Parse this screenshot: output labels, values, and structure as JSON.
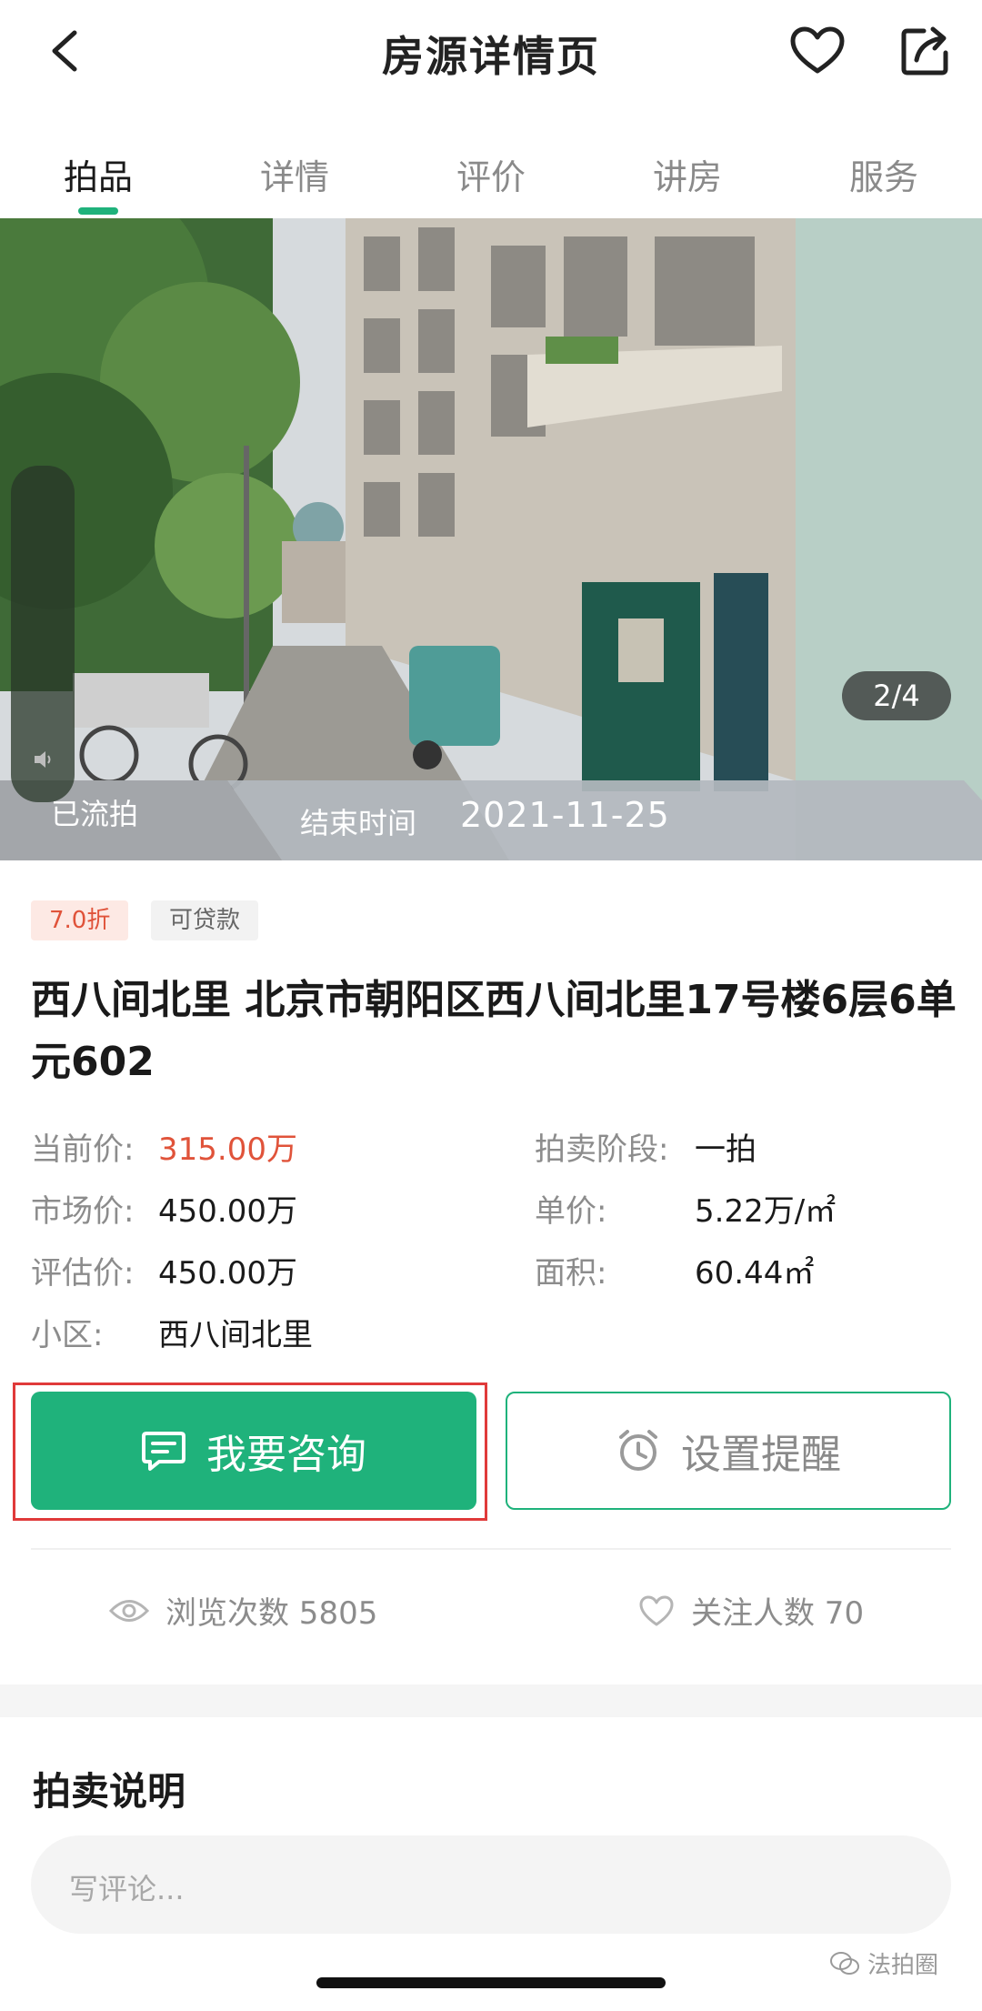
{
  "header": {
    "title": "房源详情页",
    "back_icon": "chevron-left-icon",
    "favorite_icon": "heart-icon",
    "share_icon": "share-icon"
  },
  "tabs": [
    {
      "label": "拍品",
      "active": true
    },
    {
      "label": "详情",
      "active": false
    },
    {
      "label": "评价",
      "active": false
    },
    {
      "label": "讲房",
      "active": false
    },
    {
      "label": "服务",
      "active": false
    }
  ],
  "hero": {
    "counter": "2/4",
    "status": "已流拍",
    "end_time_label": "结束时间",
    "end_time_value": "2021-11-25"
  },
  "tags": {
    "discount": "7.0折",
    "loan": "可贷款"
  },
  "property": {
    "title": "西八间北里 北京市朝阳区西八间北里17号楼6层6单元602"
  },
  "info": {
    "current_price_label": "当前价:",
    "current_price_value": "315.00万",
    "stage_label": "拍卖阶段:",
    "stage_value": "一拍",
    "market_price_label": "市场价:",
    "market_price_value": "450.00万",
    "unit_price_label": "单价:",
    "unit_price_value": "5.22万/㎡",
    "assessed_price_label": "评估价:",
    "assessed_price_value": "450.00万",
    "area_label": "面积:",
    "area_value": "60.44㎡",
    "community_label": "小区:",
    "community_value": "西八间北里"
  },
  "actions": {
    "consult_label": "我要咨询",
    "remind_label": "设置提醒"
  },
  "stats": {
    "views": "浏览次数 5805",
    "followers": "关注人数 70"
  },
  "auction_section": {
    "title": "拍卖说明",
    "comment_placeholder": "写评论..."
  },
  "watermark": "法拍圈",
  "colors": {
    "accent": "#1fb27b",
    "price": "#e0533a",
    "highlight": "#e03a3a"
  }
}
